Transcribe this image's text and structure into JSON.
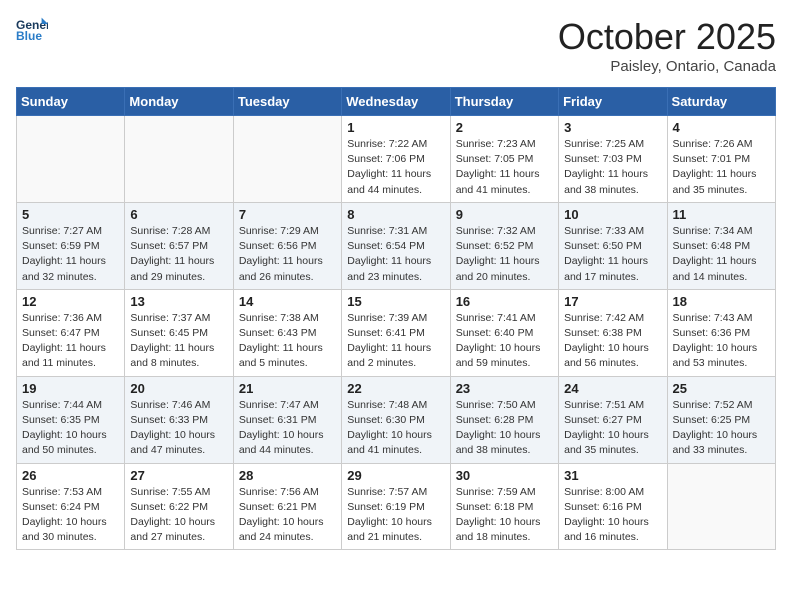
{
  "header": {
    "logo_general": "General",
    "logo_blue": "Blue",
    "month": "October 2025",
    "location": "Paisley, Ontario, Canada"
  },
  "weekdays": [
    "Sunday",
    "Monday",
    "Tuesday",
    "Wednesday",
    "Thursday",
    "Friday",
    "Saturday"
  ],
  "weeks": [
    [
      {
        "day": "",
        "info": ""
      },
      {
        "day": "",
        "info": ""
      },
      {
        "day": "",
        "info": ""
      },
      {
        "day": "1",
        "info": "Sunrise: 7:22 AM\nSunset: 7:06 PM\nDaylight: 11 hours and 44 minutes."
      },
      {
        "day": "2",
        "info": "Sunrise: 7:23 AM\nSunset: 7:05 PM\nDaylight: 11 hours and 41 minutes."
      },
      {
        "day": "3",
        "info": "Sunrise: 7:25 AM\nSunset: 7:03 PM\nDaylight: 11 hours and 38 minutes."
      },
      {
        "day": "4",
        "info": "Sunrise: 7:26 AM\nSunset: 7:01 PM\nDaylight: 11 hours and 35 minutes."
      }
    ],
    [
      {
        "day": "5",
        "info": "Sunrise: 7:27 AM\nSunset: 6:59 PM\nDaylight: 11 hours and 32 minutes."
      },
      {
        "day": "6",
        "info": "Sunrise: 7:28 AM\nSunset: 6:57 PM\nDaylight: 11 hours and 29 minutes."
      },
      {
        "day": "7",
        "info": "Sunrise: 7:29 AM\nSunset: 6:56 PM\nDaylight: 11 hours and 26 minutes."
      },
      {
        "day": "8",
        "info": "Sunrise: 7:31 AM\nSunset: 6:54 PM\nDaylight: 11 hours and 23 minutes."
      },
      {
        "day": "9",
        "info": "Sunrise: 7:32 AM\nSunset: 6:52 PM\nDaylight: 11 hours and 20 minutes."
      },
      {
        "day": "10",
        "info": "Sunrise: 7:33 AM\nSunset: 6:50 PM\nDaylight: 11 hours and 17 minutes."
      },
      {
        "day": "11",
        "info": "Sunrise: 7:34 AM\nSunset: 6:48 PM\nDaylight: 11 hours and 14 minutes."
      }
    ],
    [
      {
        "day": "12",
        "info": "Sunrise: 7:36 AM\nSunset: 6:47 PM\nDaylight: 11 hours and 11 minutes."
      },
      {
        "day": "13",
        "info": "Sunrise: 7:37 AM\nSunset: 6:45 PM\nDaylight: 11 hours and 8 minutes."
      },
      {
        "day": "14",
        "info": "Sunrise: 7:38 AM\nSunset: 6:43 PM\nDaylight: 11 hours and 5 minutes."
      },
      {
        "day": "15",
        "info": "Sunrise: 7:39 AM\nSunset: 6:41 PM\nDaylight: 11 hours and 2 minutes."
      },
      {
        "day": "16",
        "info": "Sunrise: 7:41 AM\nSunset: 6:40 PM\nDaylight: 10 hours and 59 minutes."
      },
      {
        "day": "17",
        "info": "Sunrise: 7:42 AM\nSunset: 6:38 PM\nDaylight: 10 hours and 56 minutes."
      },
      {
        "day": "18",
        "info": "Sunrise: 7:43 AM\nSunset: 6:36 PM\nDaylight: 10 hours and 53 minutes."
      }
    ],
    [
      {
        "day": "19",
        "info": "Sunrise: 7:44 AM\nSunset: 6:35 PM\nDaylight: 10 hours and 50 minutes."
      },
      {
        "day": "20",
        "info": "Sunrise: 7:46 AM\nSunset: 6:33 PM\nDaylight: 10 hours and 47 minutes."
      },
      {
        "day": "21",
        "info": "Sunrise: 7:47 AM\nSunset: 6:31 PM\nDaylight: 10 hours and 44 minutes."
      },
      {
        "day": "22",
        "info": "Sunrise: 7:48 AM\nSunset: 6:30 PM\nDaylight: 10 hours and 41 minutes."
      },
      {
        "day": "23",
        "info": "Sunrise: 7:50 AM\nSunset: 6:28 PM\nDaylight: 10 hours and 38 minutes."
      },
      {
        "day": "24",
        "info": "Sunrise: 7:51 AM\nSunset: 6:27 PM\nDaylight: 10 hours and 35 minutes."
      },
      {
        "day": "25",
        "info": "Sunrise: 7:52 AM\nSunset: 6:25 PM\nDaylight: 10 hours and 33 minutes."
      }
    ],
    [
      {
        "day": "26",
        "info": "Sunrise: 7:53 AM\nSunset: 6:24 PM\nDaylight: 10 hours and 30 minutes."
      },
      {
        "day": "27",
        "info": "Sunrise: 7:55 AM\nSunset: 6:22 PM\nDaylight: 10 hours and 27 minutes."
      },
      {
        "day": "28",
        "info": "Sunrise: 7:56 AM\nSunset: 6:21 PM\nDaylight: 10 hours and 24 minutes."
      },
      {
        "day": "29",
        "info": "Sunrise: 7:57 AM\nSunset: 6:19 PM\nDaylight: 10 hours and 21 minutes."
      },
      {
        "day": "30",
        "info": "Sunrise: 7:59 AM\nSunset: 6:18 PM\nDaylight: 10 hours and 18 minutes."
      },
      {
        "day": "31",
        "info": "Sunrise: 8:00 AM\nSunset: 6:16 PM\nDaylight: 10 hours and 16 minutes."
      },
      {
        "day": "",
        "info": ""
      }
    ]
  ]
}
